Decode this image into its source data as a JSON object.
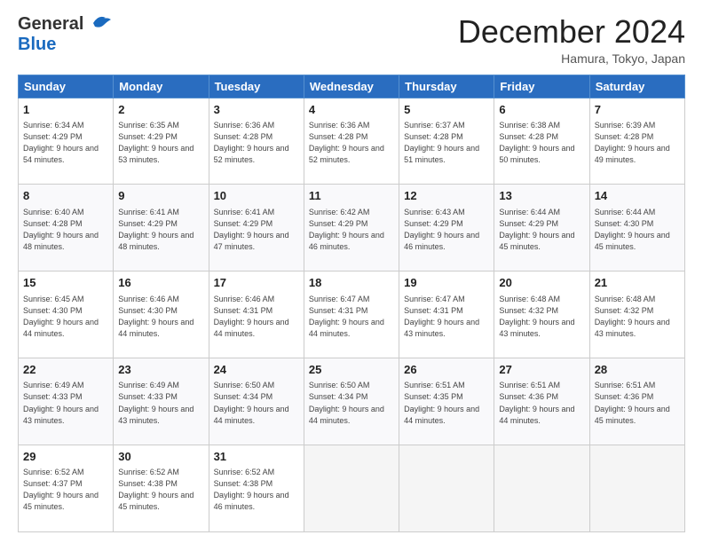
{
  "header": {
    "logo_general": "General",
    "logo_blue": "Blue",
    "month_title": "December 2024",
    "location": "Hamura, Tokyo, Japan"
  },
  "days_of_week": [
    "Sunday",
    "Monday",
    "Tuesday",
    "Wednesday",
    "Thursday",
    "Friday",
    "Saturday"
  ],
  "weeks": [
    [
      {
        "day": "1",
        "sunrise": "6:34 AM",
        "sunset": "4:29 PM",
        "daylight_h": "9",
        "daylight_m": "54"
      },
      {
        "day": "2",
        "sunrise": "6:35 AM",
        "sunset": "4:29 PM",
        "daylight_h": "9",
        "daylight_m": "53"
      },
      {
        "day": "3",
        "sunrise": "6:36 AM",
        "sunset": "4:28 PM",
        "daylight_h": "9",
        "daylight_m": "52"
      },
      {
        "day": "4",
        "sunrise": "6:36 AM",
        "sunset": "4:28 PM",
        "daylight_h": "9",
        "daylight_m": "52"
      },
      {
        "day": "5",
        "sunrise": "6:37 AM",
        "sunset": "4:28 PM",
        "daylight_h": "9",
        "daylight_m": "51"
      },
      {
        "day": "6",
        "sunrise": "6:38 AM",
        "sunset": "4:28 PM",
        "daylight_h": "9",
        "daylight_m": "50"
      },
      {
        "day": "7",
        "sunrise": "6:39 AM",
        "sunset": "4:28 PM",
        "daylight_h": "9",
        "daylight_m": "49"
      }
    ],
    [
      {
        "day": "8",
        "sunrise": "6:40 AM",
        "sunset": "4:28 PM",
        "daylight_h": "9",
        "daylight_m": "48"
      },
      {
        "day": "9",
        "sunrise": "6:41 AM",
        "sunset": "4:29 PM",
        "daylight_h": "9",
        "daylight_m": "48"
      },
      {
        "day": "10",
        "sunrise": "6:41 AM",
        "sunset": "4:29 PM",
        "daylight_h": "9",
        "daylight_m": "47"
      },
      {
        "day": "11",
        "sunrise": "6:42 AM",
        "sunset": "4:29 PM",
        "daylight_h": "9",
        "daylight_m": "46"
      },
      {
        "day": "12",
        "sunrise": "6:43 AM",
        "sunset": "4:29 PM",
        "daylight_h": "9",
        "daylight_m": "46"
      },
      {
        "day": "13",
        "sunrise": "6:44 AM",
        "sunset": "4:29 PM",
        "daylight_h": "9",
        "daylight_m": "45"
      },
      {
        "day": "14",
        "sunrise": "6:44 AM",
        "sunset": "4:30 PM",
        "daylight_h": "9",
        "daylight_m": "45"
      }
    ],
    [
      {
        "day": "15",
        "sunrise": "6:45 AM",
        "sunset": "4:30 PM",
        "daylight_h": "9",
        "daylight_m": "44"
      },
      {
        "day": "16",
        "sunrise": "6:46 AM",
        "sunset": "4:30 PM",
        "daylight_h": "9",
        "daylight_m": "44"
      },
      {
        "day": "17",
        "sunrise": "6:46 AM",
        "sunset": "4:31 PM",
        "daylight_h": "9",
        "daylight_m": "44"
      },
      {
        "day": "18",
        "sunrise": "6:47 AM",
        "sunset": "4:31 PM",
        "daylight_h": "9",
        "daylight_m": "44"
      },
      {
        "day": "19",
        "sunrise": "6:47 AM",
        "sunset": "4:31 PM",
        "daylight_h": "9",
        "daylight_m": "43"
      },
      {
        "day": "20",
        "sunrise": "6:48 AM",
        "sunset": "4:32 PM",
        "daylight_h": "9",
        "daylight_m": "43"
      },
      {
        "day": "21",
        "sunrise": "6:48 AM",
        "sunset": "4:32 PM",
        "daylight_h": "9",
        "daylight_m": "43"
      }
    ],
    [
      {
        "day": "22",
        "sunrise": "6:49 AM",
        "sunset": "4:33 PM",
        "daylight_h": "9",
        "daylight_m": "43"
      },
      {
        "day": "23",
        "sunrise": "6:49 AM",
        "sunset": "4:33 PM",
        "daylight_h": "9",
        "daylight_m": "43"
      },
      {
        "day": "24",
        "sunrise": "6:50 AM",
        "sunset": "4:34 PM",
        "daylight_h": "9",
        "daylight_m": "44"
      },
      {
        "day": "25",
        "sunrise": "6:50 AM",
        "sunset": "4:34 PM",
        "daylight_h": "9",
        "daylight_m": "44"
      },
      {
        "day": "26",
        "sunrise": "6:51 AM",
        "sunset": "4:35 PM",
        "daylight_h": "9",
        "daylight_m": "44"
      },
      {
        "day": "27",
        "sunrise": "6:51 AM",
        "sunset": "4:36 PM",
        "daylight_h": "9",
        "daylight_m": "44"
      },
      {
        "day": "28",
        "sunrise": "6:51 AM",
        "sunset": "4:36 PM",
        "daylight_h": "9",
        "daylight_m": "45"
      }
    ],
    [
      {
        "day": "29",
        "sunrise": "6:52 AM",
        "sunset": "4:37 PM",
        "daylight_h": "9",
        "daylight_m": "45"
      },
      {
        "day": "30",
        "sunrise": "6:52 AM",
        "sunset": "4:38 PM",
        "daylight_h": "9",
        "daylight_m": "45"
      },
      {
        "day": "31",
        "sunrise": "6:52 AM",
        "sunset": "4:38 PM",
        "daylight_h": "9",
        "daylight_m": "46"
      },
      null,
      null,
      null,
      null
    ]
  ],
  "labels": {
    "sunrise": "Sunrise:",
    "sunset": "Sunset:",
    "daylight": "Daylight: {h} hours and {m} minutes."
  }
}
